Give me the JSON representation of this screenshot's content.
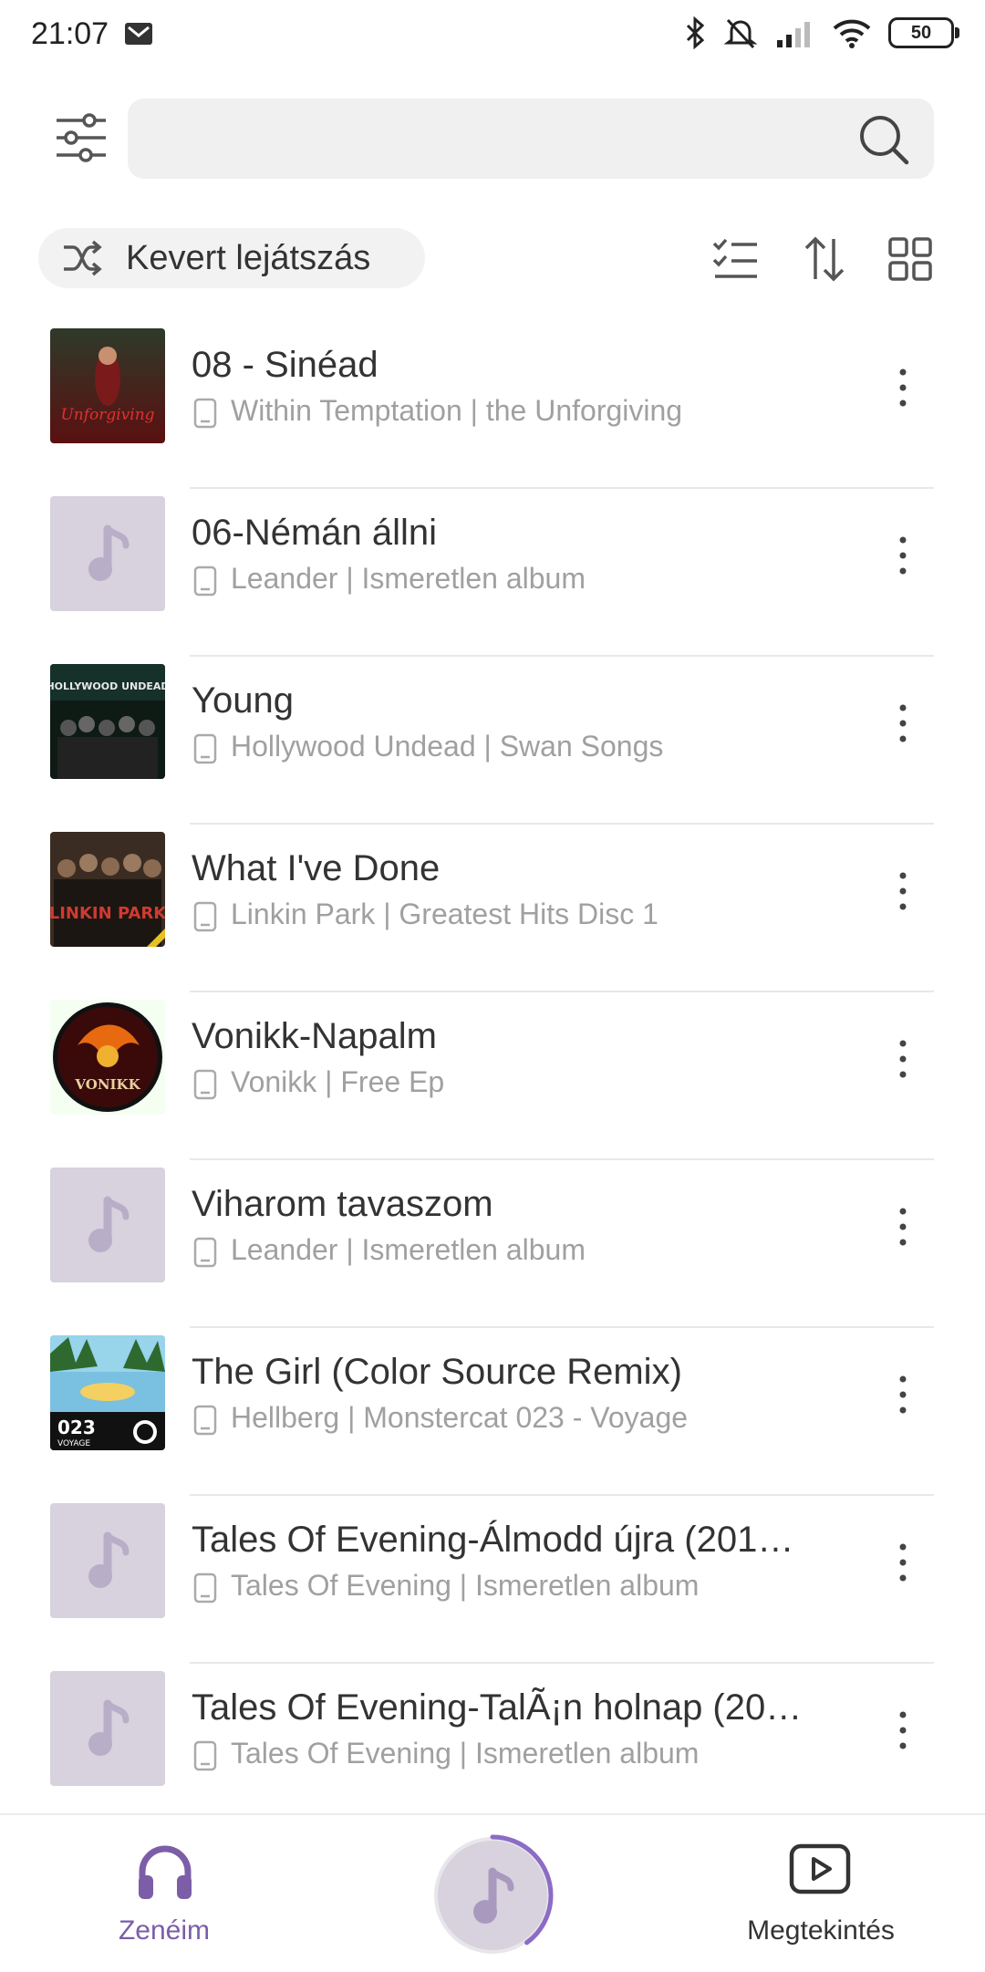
{
  "status_bar": {
    "time": "21:07",
    "battery": "50"
  },
  "search": {
    "value": "",
    "placeholder": ""
  },
  "toolbar": {
    "shuffle_label": "Kevert lejátszás"
  },
  "songs": [
    {
      "title": "08 - Sinéad",
      "subtitle": "Within Temptation | the Unforgiving",
      "art": "cover-unforgiving"
    },
    {
      "title": "06-Némán állni",
      "subtitle": "Leander | Ismeretlen album",
      "art": "placeholder"
    },
    {
      "title": "Young",
      "subtitle": "Hollywood Undead | Swan Songs",
      "art": "cover-swan-songs"
    },
    {
      "title": "What I've Done",
      "subtitle": "Linkin Park | Greatest Hits Disc 1",
      "art": "cover-linkin-park"
    },
    {
      "title": "Vonikk-Napalm",
      "subtitle": "Vonikk | Free Ep",
      "art": "cover-vonikk"
    },
    {
      "title": "Viharom tavaszom",
      "subtitle": "Leander | Ismeretlen album",
      "art": "placeholder"
    },
    {
      "title": "The Girl (Color Source Remix)",
      "subtitle": "Hellberg | Monstercat 023 - Voyage",
      "art": "cover-monstercat"
    },
    {
      "title": "Tales Of Evening-Álmodd újra (201…",
      "subtitle": "Tales Of Evening | Ismeretlen album",
      "art": "placeholder"
    },
    {
      "title": "Tales Of Evening-TalÃ¡n holnap (20…",
      "subtitle": "Tales Of Evening | Ismeretlen album",
      "art": "placeholder"
    }
  ],
  "cover_texts": {
    "unforgiving": "Unforgiving",
    "hollywood_undead": "HOLLYWOOD UNDEAD",
    "linkin_park": "LINKIN PARK",
    "vonikk": "VONIKK",
    "monstercat_num": "023",
    "monstercat_sub": "VOYAGE"
  },
  "bottom_nav": {
    "music_label": "Zenéim",
    "watch_label": "Megtekintés"
  },
  "colors": {
    "accent": "#7b5ea7",
    "placeholder_bg": "#d7d2de",
    "placeholder_note": "#b8aec8",
    "text_primary": "#333333",
    "text_secondary": "#a0a0a0"
  },
  "player": {
    "progress": 0.4
  }
}
